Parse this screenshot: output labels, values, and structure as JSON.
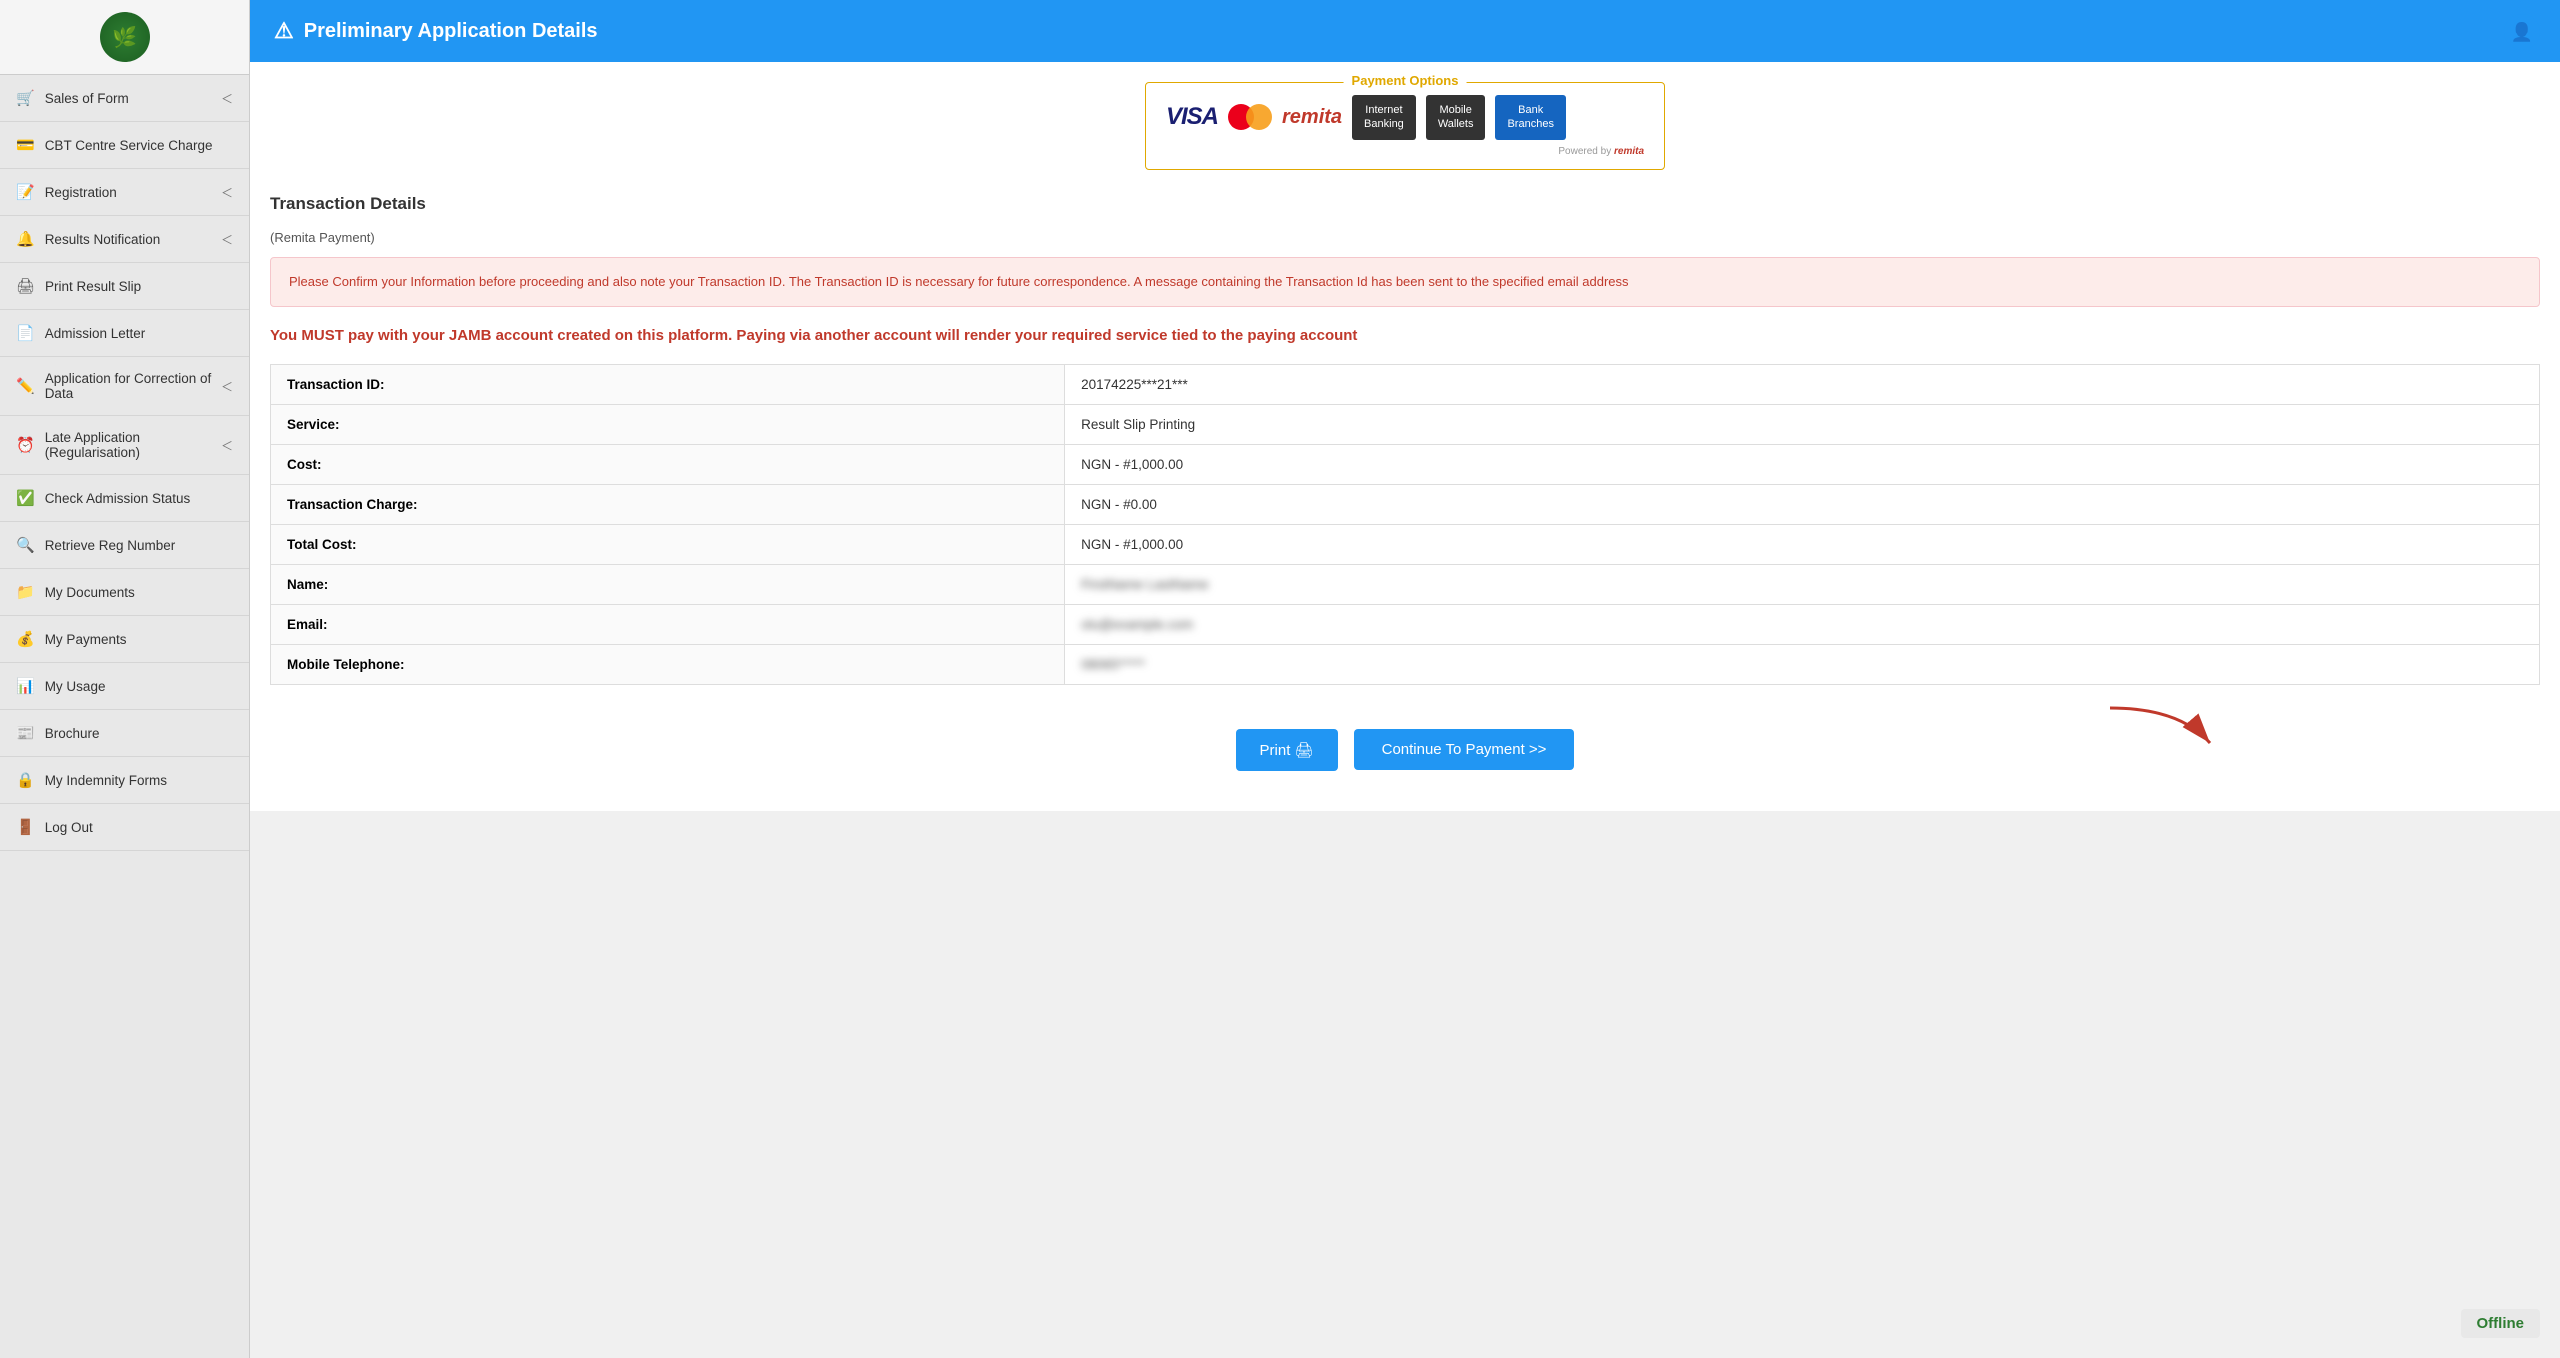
{
  "sidebar": {
    "items": [
      {
        "id": "sales-of-form",
        "label": "Sales of Form",
        "icon": "🛒",
        "hasChevron": true
      },
      {
        "id": "cbt-centre",
        "label": "CBT Centre Service Charge",
        "icon": "💳",
        "hasChevron": false
      },
      {
        "id": "registration",
        "label": "Registration",
        "icon": "📝",
        "hasChevron": true
      },
      {
        "id": "results-notification",
        "label": "Results Notification",
        "icon": "🔔",
        "hasChevron": true
      },
      {
        "id": "print-result-slip",
        "label": "Print Result Slip",
        "icon": "🖨",
        "hasChevron": false
      },
      {
        "id": "admission-letter",
        "label": "Admission Letter",
        "icon": "📄",
        "hasChevron": false
      },
      {
        "id": "application-correction",
        "label": "Application for Correction of Data",
        "icon": "✏️",
        "hasChevron": true
      },
      {
        "id": "late-application",
        "label": "Late Application (Regularisation)",
        "icon": "⏰",
        "hasChevron": true
      },
      {
        "id": "check-admission",
        "label": "Check Admission Status",
        "icon": "✅",
        "hasChevron": false
      },
      {
        "id": "retrieve-reg",
        "label": "Retrieve Reg Number",
        "icon": "🔍",
        "hasChevron": false
      },
      {
        "id": "my-documents",
        "label": "My Documents",
        "icon": "📁",
        "hasChevron": false
      },
      {
        "id": "my-payments",
        "label": "My Payments",
        "icon": "💰",
        "hasChevron": false
      },
      {
        "id": "my-usage",
        "label": "My Usage",
        "icon": "📊",
        "hasChevron": false
      },
      {
        "id": "brochure",
        "label": "Brochure",
        "icon": "📰",
        "hasChevron": false
      },
      {
        "id": "my-indemnity",
        "label": "My Indemnity Forms",
        "icon": "🔒",
        "hasChevron": false
      },
      {
        "id": "log-out",
        "label": "Log Out",
        "icon": "🚪",
        "hasChevron": false
      }
    ]
  },
  "header": {
    "title": "Preliminary Application Details",
    "warning_icon": "⚠"
  },
  "payment_options": {
    "label": "Payment Options",
    "powered_by": "Powered by",
    "remita_powered": "remita",
    "buttons": [
      {
        "id": "internet-banking",
        "line1": "Internet",
        "line2": "Banking"
      },
      {
        "id": "mobile-wallets",
        "line1": "Mobile",
        "line2": "Wallets"
      },
      {
        "id": "bank-branches",
        "line1": "Bank",
        "line2": "Branches"
      }
    ]
  },
  "transaction": {
    "section_title": "Transaction Details",
    "remita_label": "(Remita Payment)",
    "alert_message": "Please Confirm your Information before proceeding and also note your Transaction ID. The Transaction ID is necessary for future correspondence. A message containing the Transaction Id has been sent to the specified email address",
    "warning_text": "You MUST pay with your JAMB account created on this platform. Paying via another account will render your required service tied to the paying account",
    "rows": [
      {
        "label": "Transaction ID:",
        "value": "20174225***21***",
        "blurred": false
      },
      {
        "label": "Service:",
        "value": "Result Slip Printing",
        "blurred": false
      },
      {
        "label": "Cost:",
        "value": "NGN - #1,000.00",
        "blurred": false
      },
      {
        "label": "Transaction Charge:",
        "value": "NGN - #0.00",
        "blurred": false
      },
      {
        "label": "Total Cost:",
        "value": "NGN - #1,000.00",
        "blurred": false
      },
      {
        "label": "Name:",
        "value": "FirstName LastName",
        "blurred": true
      },
      {
        "label": "Email:",
        "value": "olu@example.com",
        "blurred": true
      },
      {
        "label": "Mobile Telephone:",
        "value": "08065*****",
        "blurred": true
      }
    ],
    "print_label": "Print 🖨",
    "continue_label": "Continue To Payment >>"
  },
  "offline_badge": "Offline"
}
